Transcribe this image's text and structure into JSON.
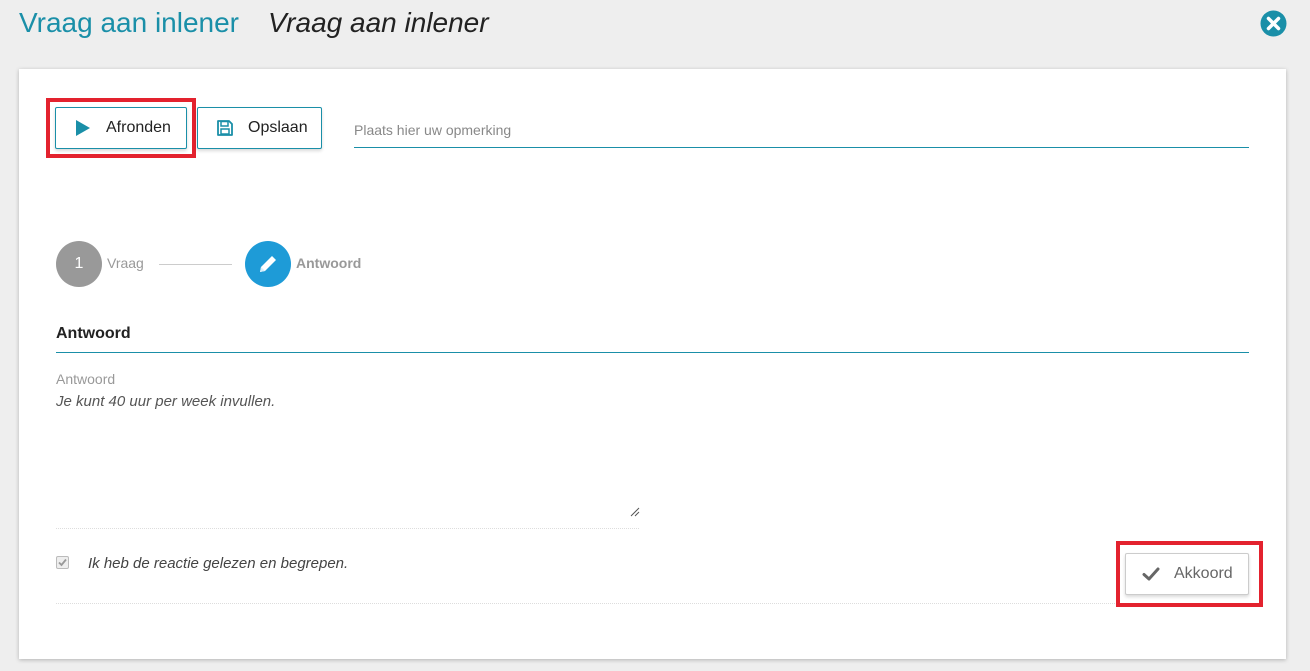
{
  "header": {
    "title": "Vraag aan inlener",
    "subtitle": "Vraag aan inlener",
    "close_icon": "close-circle-icon"
  },
  "toolbar": {
    "finish_label": "Afronden",
    "finish_icon": "play-icon",
    "save_label": "Opslaan",
    "save_icon": "save-icon",
    "remark_placeholder": "Plaats hier uw opmerking"
  },
  "steps": [
    {
      "number": "1",
      "label": "Vraag",
      "state": "done"
    },
    {
      "icon": "pencil-icon",
      "label": "Antwoord",
      "state": "active"
    }
  ],
  "answer": {
    "section_title": "Antwoord",
    "field_label": "Antwoord",
    "text": "Je kunt 40 uur per week invullen."
  },
  "confirm": {
    "checkbox_label": "Ik heb de reactie gelezen en begrepen.",
    "checked": true,
    "agree_label": "Akkoord",
    "agree_icon": "check-icon"
  },
  "colors": {
    "accent": "#1a8fa8",
    "step_active": "#1e9bd7",
    "step_done": "#999999",
    "highlight": "#e3222e"
  }
}
